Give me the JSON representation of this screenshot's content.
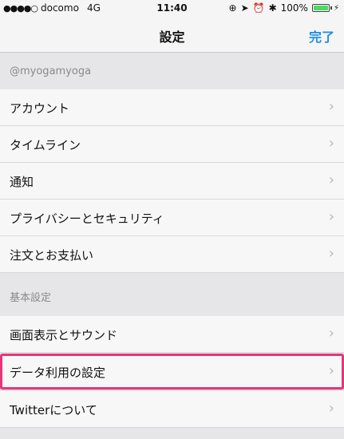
{
  "status": {
    "signal_dots": "●●●●○",
    "carrier": "docomo",
    "network": "4G",
    "time": "11:40",
    "battery": "100%"
  },
  "nav": {
    "title": "設定",
    "done_label": "完了"
  },
  "account_section": {
    "header": "@myogamyoga",
    "items": [
      {
        "label": "アカウント"
      },
      {
        "label": "タイムライン"
      },
      {
        "label": "通知"
      },
      {
        "label": "プライバシーとセキュリティ"
      },
      {
        "label": "注文とお支払い"
      }
    ]
  },
  "general_section": {
    "header": "基本設定",
    "items": [
      {
        "label": "画面表示とサウンド"
      },
      {
        "label": "データ利用の設定"
      },
      {
        "label": "Twitterについて"
      }
    ]
  },
  "chevron": "›"
}
